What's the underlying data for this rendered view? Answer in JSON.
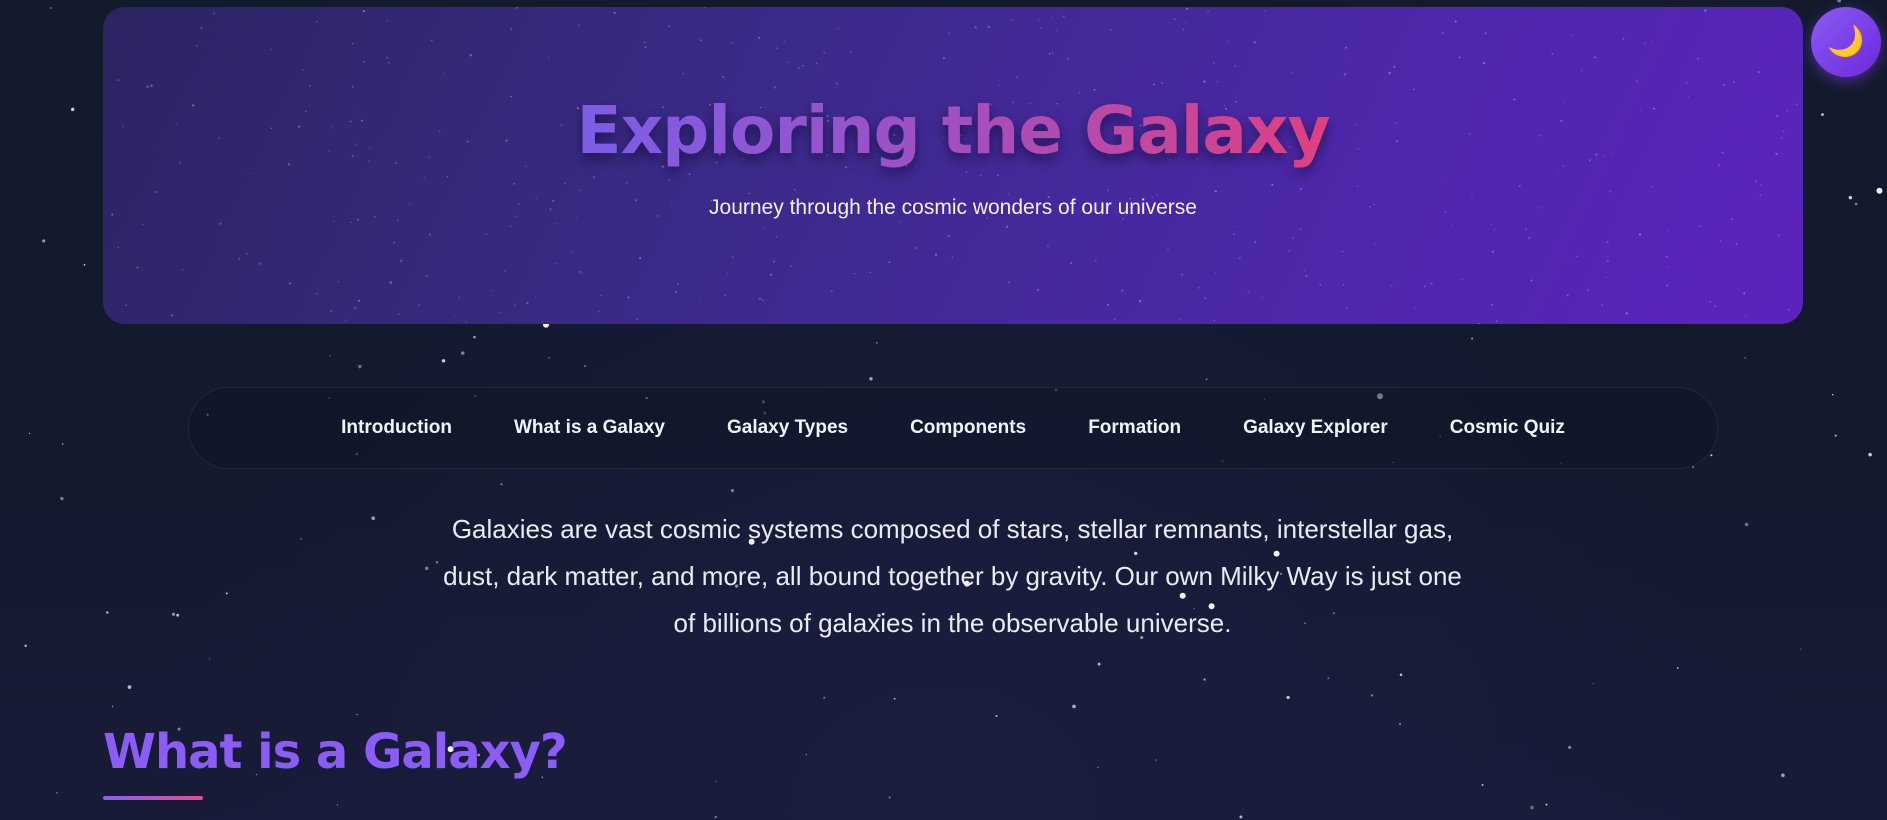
{
  "hero": {
    "title": "Exploring the Galaxy",
    "subtitle": "Journey through the cosmic wonders of our universe"
  },
  "theme_toggle": {
    "icon": "moon-icon",
    "glyph": "🌙"
  },
  "nav": {
    "items": [
      {
        "label": "Introduction"
      },
      {
        "label": "What is a Galaxy"
      },
      {
        "label": "Galaxy Types"
      },
      {
        "label": "Components"
      },
      {
        "label": "Formation"
      },
      {
        "label": "Galaxy Explorer"
      },
      {
        "label": "Cosmic Quiz"
      }
    ]
  },
  "intro": {
    "text": "Galaxies are vast cosmic systems composed of stars, stellar remnants, interstellar gas, dust, dark matter, and more, all bound together by gravity. Our own Milky Way is just one of billions of galaxies in the observable universe."
  },
  "section": {
    "title": "What is a Galaxy?"
  },
  "colors": {
    "background": "#131a2c",
    "hero_start": "#2c2462",
    "hero_end": "#5b23bd",
    "accent": "#8b5cf6",
    "pink": "#ec4899"
  }
}
